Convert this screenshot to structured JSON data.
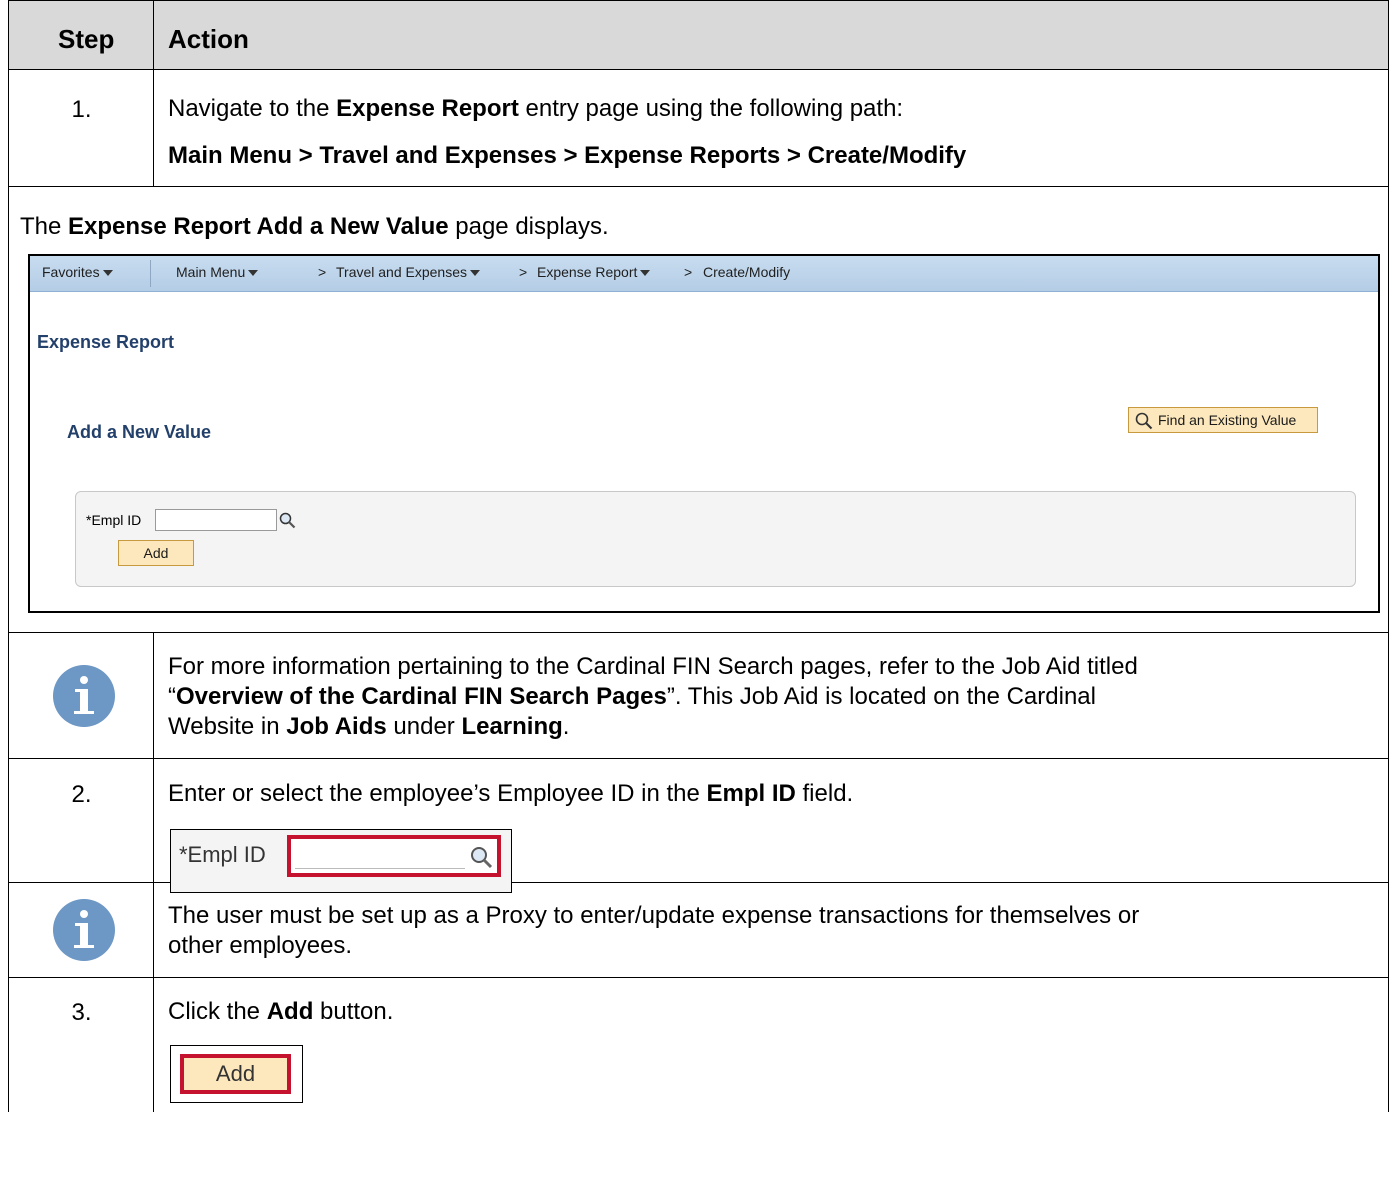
{
  "header": {
    "step": "Step",
    "action": "Action"
  },
  "step1": {
    "num": "1.",
    "line1_pre": "Navigate to the ",
    "line1_bold": "Expense Report",
    "line1_post": " entry page using the following path:",
    "path": "Main Menu > Travel and Expenses > Expense Reports > Create/Modify"
  },
  "note1": {
    "pre": "The ",
    "bold": "Expense Report Add a New Value",
    "post": " page displays."
  },
  "screenshot": {
    "nav": {
      "favorites": "Favorites",
      "main_menu": "Main Menu",
      "travel": "Travel and Expenses",
      "expense_report": "Expense Report",
      "create_modify": "Create/Modify",
      "separator": ">"
    },
    "page_title": "Expense Report",
    "sub_title": "Add a New Value",
    "find_button": "Find an Existing Value",
    "empl_label": "*Empl ID",
    "add_button": "Add"
  },
  "info1": {
    "p1": "For more information pertaining to the Cardinal FIN Search pages, refer to the Job Aid titled",
    "quote_open": "“",
    "bold_title": "Overview of the Cardinal FIN Search Pages",
    "quote_close": "”.  This Job Aid is located on the Cardinal",
    "p3_pre": "Website in ",
    "job_aids": "Job Aids",
    "under": " under ",
    "learning": "Learning",
    "period": "."
  },
  "step2": {
    "num": "2.",
    "pre": "Enter or select the employee’s Employee ID in the ",
    "bold": "Empl ID",
    "post": " field.",
    "crop_label": "*Empl ID"
  },
  "info2": {
    "line1": "The user must be set up as a Proxy to enter/update expense transactions for themselves or",
    "line2": "other employees."
  },
  "step3": {
    "num": "3.",
    "pre": "Click the ",
    "bold": "Add",
    "post": " button.",
    "crop_button": "Add"
  }
}
